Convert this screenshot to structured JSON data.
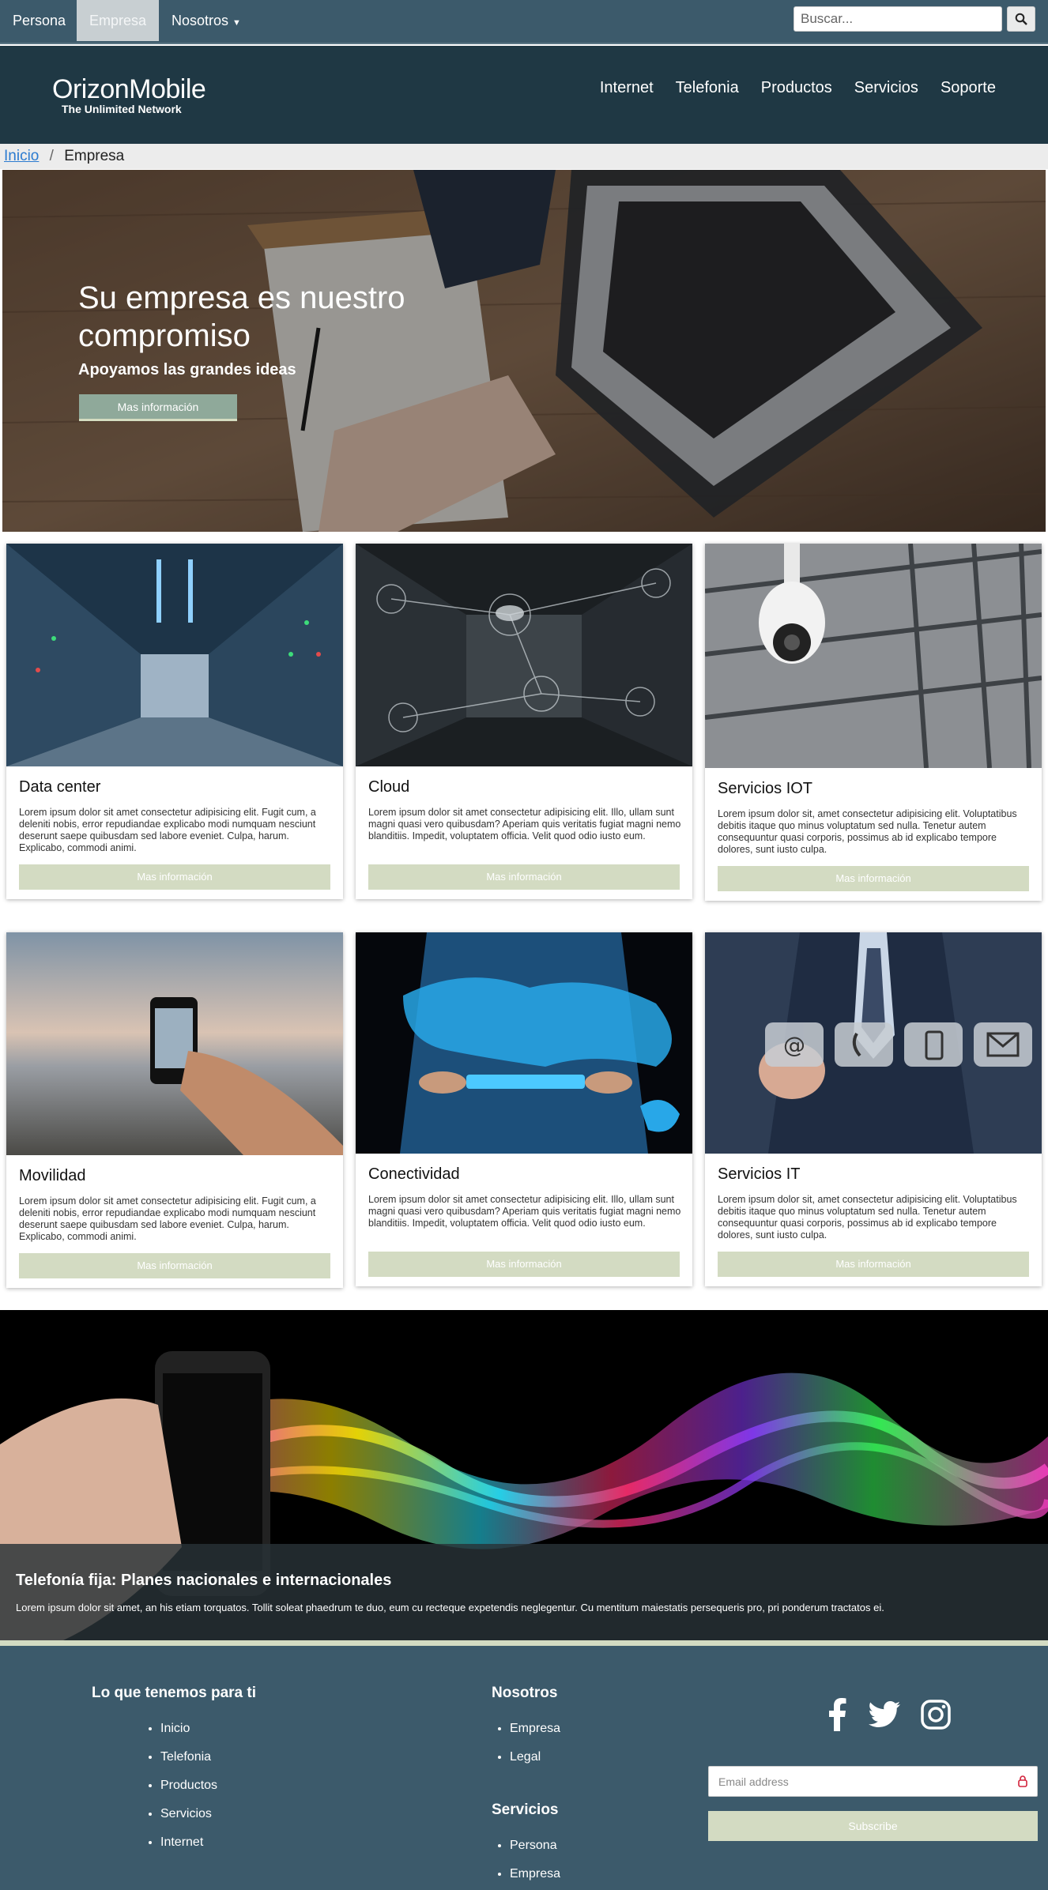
{
  "topbar": {
    "tabs": [
      {
        "label": "Persona"
      },
      {
        "label": "Empresa"
      },
      {
        "label": "Nosotros"
      }
    ],
    "search_placeholder": "Buscar..."
  },
  "brand": {
    "name": "OrizonMobile",
    "tagline": "The Unlimited Network"
  },
  "nav": [
    "Internet",
    "Telefonia",
    "Productos",
    "Servicios",
    "Soporte"
  ],
  "breadcrumb": {
    "home": "Inicio",
    "separator": "/",
    "current": "Empresa"
  },
  "hero": {
    "title": "Su empresa es nuestro compromiso",
    "subtitle": "Apoyamos las grandes ideas",
    "button": "Mas información"
  },
  "cards": [
    {
      "title": "Data center",
      "text": "Lorem ipsum dolor sit amet consectetur adipisicing elit. Fugit cum, a deleniti nobis, error repudiandae explicabo modi numquam nesciunt deserunt saepe quibusdam sed labore eveniet. Culpa, harum. Explicabo, commodi animi.",
      "button": "Mas información"
    },
    {
      "title": "Cloud",
      "text": "Lorem ipsum dolor sit amet consectetur adipisicing elit. Illo, ullam sunt magni quasi vero quibusdam? Aperiam quis veritatis fugiat magni nemo blanditiis. Impedit, voluptatem officia. Velit quod odio iusto eum.",
      "button": "Mas información"
    },
    {
      "title": "Servicios IOT",
      "text": "Lorem ipsum dolor sit, amet consectetur adipisicing elit. Voluptatibus debitis itaque quo minus voluptatum sed nulla. Tenetur autem consequuntur quasi corporis, possimus ab id explicabo tempore dolores, sunt iusto culpa.",
      "button": "Mas información"
    },
    {
      "title": "Movilidad",
      "text": "Lorem ipsum dolor sit amet consectetur adipisicing elit. Fugit cum, a deleniti nobis, error repudiandae explicabo modi numquam nesciunt deserunt saepe quibusdam sed labore eveniet. Culpa, harum. Explicabo, commodi animi.",
      "button": "Mas información"
    },
    {
      "title": "Conectividad",
      "text": "Lorem ipsum dolor sit amet consectetur adipisicing elit. Illo, ullam sunt magni quasi vero quibusdam? Aperiam quis veritatis fugiat magni nemo blanditiis. Impedit, voluptatem officia. Velit quod odio iusto eum.",
      "button": "Mas información"
    },
    {
      "title": "Servicios IT",
      "text": "Lorem ipsum dolor sit, amet consectetur adipisicing elit. Voluptatibus debitis itaque quo minus voluptatum sed nulla. Tenetur autem consequuntur quasi corporis, possimus ab id explicabo tempore dolores, sunt iusto culpa.",
      "button": "Mas información"
    }
  ],
  "banner": {
    "title": "Telefonía fija: Planes nacionales e internacionales",
    "text": "Lorem ipsum dolor sit amet, an his etiam torquatos. Tollit soleat phaedrum te duo, eum cu recteque expetendis neglegentur. Cu mentitum maiestatis persequeris pro, pri ponderum tractatos ei."
  },
  "footer": {
    "col1_title": "Lo que tenemos para ti",
    "col1_items": [
      "Inicio",
      "Telefonia",
      "Productos",
      "Servicios",
      "Internet"
    ],
    "col2_title": "Nosotros",
    "col2_items": [
      "Empresa",
      "Legal"
    ],
    "col3_title": "Servicios",
    "col3_items": [
      "Persona",
      "Empresa"
    ],
    "social": [
      "facebook-icon",
      "twitter-icon",
      "instagram-icon"
    ],
    "email_placeholder": "Email address",
    "subscribe": "Subscribe"
  },
  "colors": {
    "topbar": "#3c5a6b",
    "header": "#1f3844",
    "accent": "#d3dbc2",
    "link": "#2b7bd0"
  }
}
